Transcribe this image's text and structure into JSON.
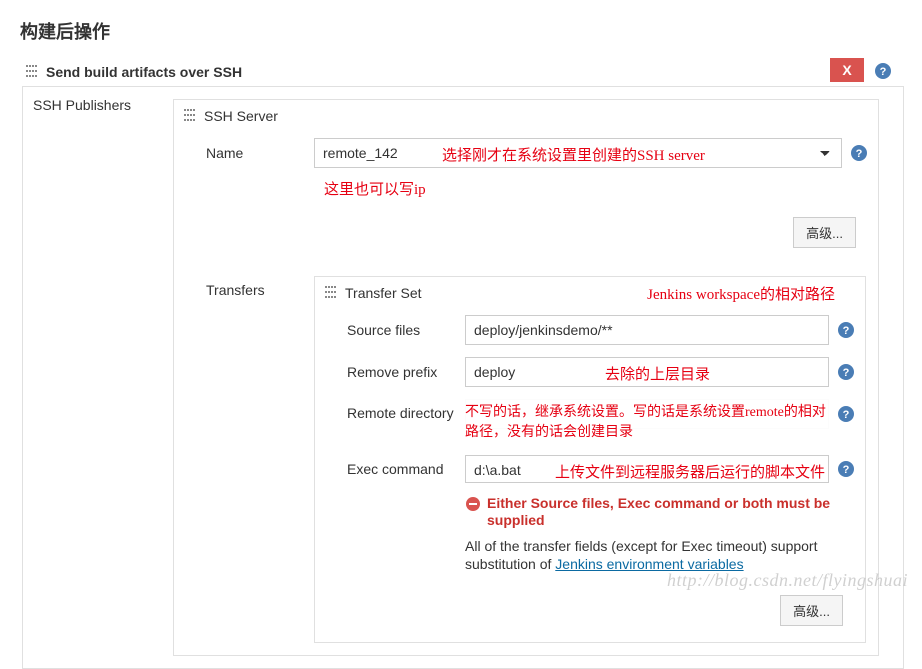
{
  "page": {
    "title": "构建后操作"
  },
  "section": {
    "title": "Send build artifacts over SSH"
  },
  "publishers": {
    "label": "SSH Publishers"
  },
  "sshServer": {
    "header": "SSH Server",
    "nameLabel": "Name",
    "nameValue": "remote_142",
    "annotationSelect": "选择刚才在系统设置里创建的SSH server",
    "noteUnder": "这里也可以写ip",
    "advancedBtn": "高级..."
  },
  "transfers": {
    "label": "Transfers",
    "setHeader": "Transfer Set",
    "workspaceNote": "Jenkins workspace的相对路径",
    "sourceLabel": "Source files",
    "sourceValue": "deploy/jenkinsdemo/**",
    "removeLabel": "Remove prefix",
    "removeValue": "deploy",
    "removeNote": "去除的上层目录",
    "remoteDirLabel": "Remote directory",
    "remoteDirValue": "",
    "remoteDirNote": "不写的话，继承系统设置。写的话是系统设置remote的相对路径，没有的话会创建目录",
    "execLabel": "Exec command",
    "execValue": "d:\\a.bat",
    "execNote": "上传文件到远程服务器后运行的脚本文件",
    "error": "Either Source files, Exec command or both must be supplied",
    "infoPrefix": "All of the transfer fields (except for Exec timeout) support substitution of ",
    "infoLink": "Jenkins environment variables",
    "advancedBtn": "高级..."
  },
  "watermark": "http://blog.csdn.net/flyingshuai"
}
